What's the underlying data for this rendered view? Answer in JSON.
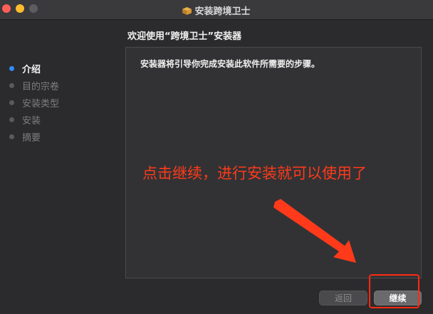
{
  "window": {
    "title": "安装跨境卫士",
    "title_icon": "package-icon"
  },
  "page": {
    "heading": "欢迎使用“跨境卫士”安装器"
  },
  "sidebar": {
    "steps": [
      {
        "label": "介绍",
        "active": true
      },
      {
        "label": "目的宗卷",
        "active": false
      },
      {
        "label": "安装类型",
        "active": false
      },
      {
        "label": "安装",
        "active": false
      },
      {
        "label": "摘要",
        "active": false
      }
    ]
  },
  "content": {
    "intro": "安装器将引导你完成安装此软件所需要的步骤。"
  },
  "annotation": {
    "text": "点击继续，进行安装就可以使用了"
  },
  "buttons": {
    "back": "返回",
    "continue": "继续"
  },
  "colors": {
    "annotation": "#ff3a1a",
    "active_step": "#2f8cff"
  }
}
